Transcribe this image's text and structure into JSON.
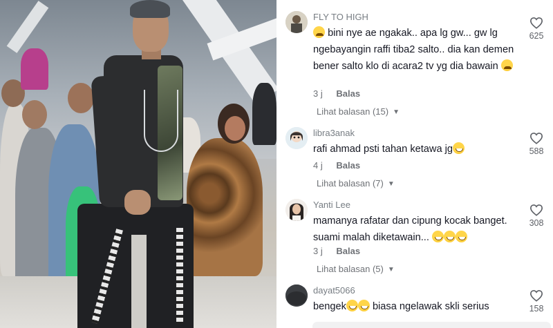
{
  "video": {},
  "comments": [
    {
      "username": "FLY TO HIGH",
      "text": "bini nye ae ngakak.. apa lg gw... gw lg ngebayangin raffi tiba2 salto.. dia kan demen bener salto klo di acara2 tv yg dia bawain",
      "emoji_start": "crying-face-emoji",
      "emoji_end": "crying-face-emoji",
      "time": "3 j",
      "reply_label": "Balas",
      "replies_label": "Lihat balasan (15)",
      "likes": "625"
    },
    {
      "username": "libra3anak",
      "text": "rafi ahmad psti tahan ketawa jg",
      "emoji_end": "grinning-face-emoji",
      "time": "4 j",
      "reply_label": "Balas",
      "replies_label": "Lihat balasan (7)",
      "likes": "588"
    },
    {
      "username": "Yanti Lee",
      "text": "mamanya rafatar dan cipung kocak banget. suami malah diketawain...",
      "emoji_end": "grinning-face-emoji x3",
      "time": "3 j",
      "reply_label": "Balas",
      "replies_label": "Lihat balasan (5)",
      "likes": "308"
    },
    {
      "username": "dayat5066",
      "text_before": "bengek",
      "text_after": " biasa ngelawak skli serius",
      "emoji_mid": "tears-of-joy-emoji x2",
      "likes": "158"
    }
  ],
  "colors": {
    "text": "#161823",
    "muted": "#6e7176",
    "like_icon": "#5d6066"
  }
}
